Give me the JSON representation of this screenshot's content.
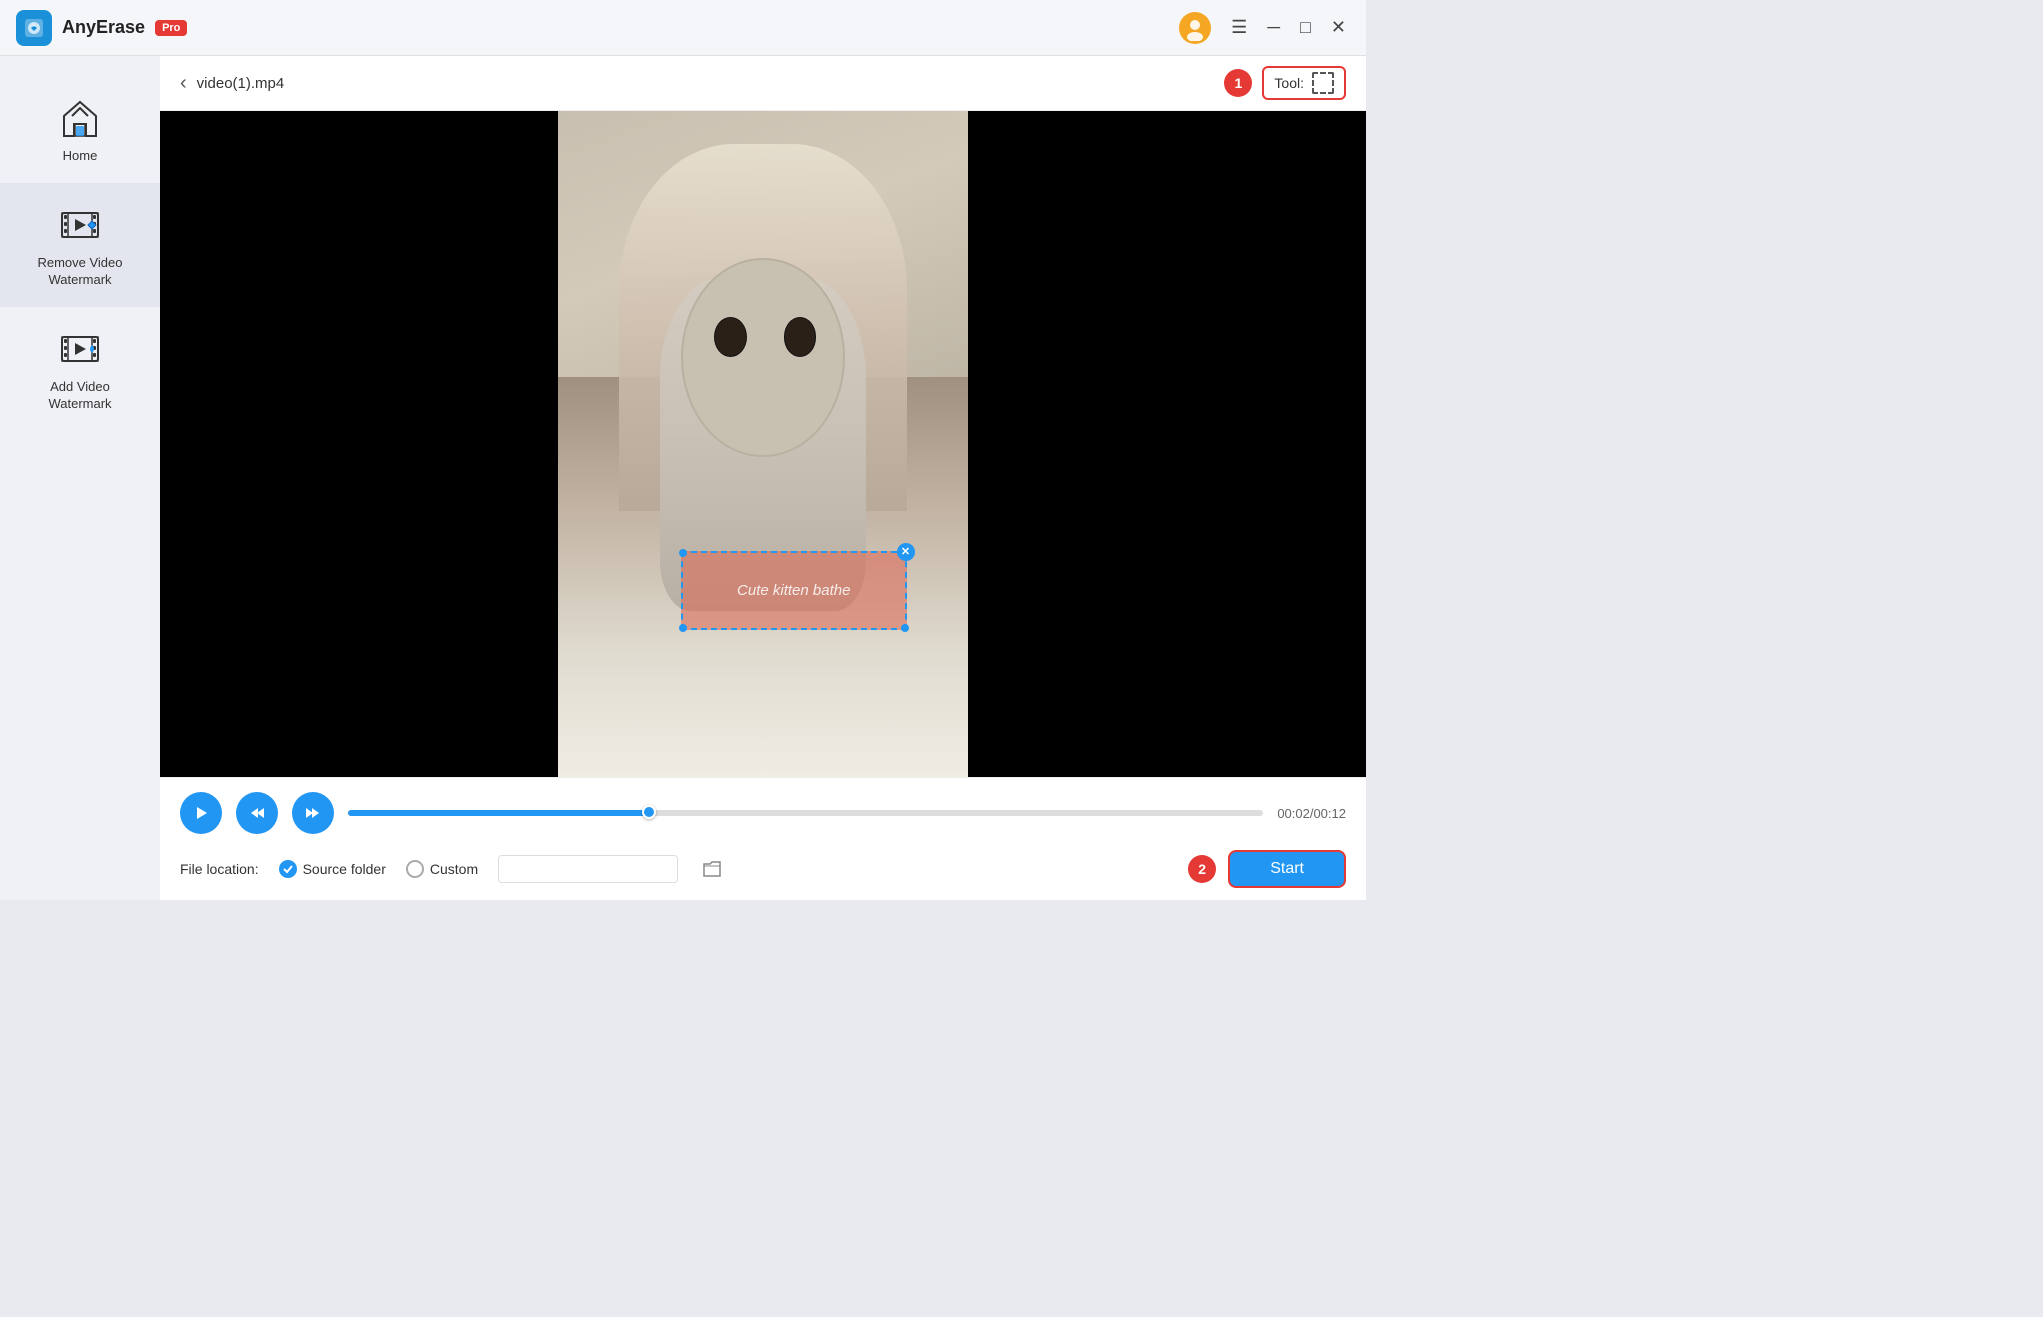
{
  "titlebar": {
    "app_name": "AnyErase",
    "pro_badge": "Pro",
    "avatar_symbol": "👤"
  },
  "sidebar": {
    "items": [
      {
        "id": "home",
        "label": "Home",
        "active": false
      },
      {
        "id": "remove-watermark",
        "label": "Remove Video\nWatermark",
        "active": true
      },
      {
        "id": "add-watermark",
        "label": "Add Video\nWatermark",
        "active": false
      }
    ]
  },
  "content_header": {
    "back_label": "‹",
    "file_name": "video(1).mp4",
    "step1_badge": "1",
    "tool_label": "Tool:",
    "step2_badge": "2"
  },
  "video": {
    "watermark_text": "Cute kitten bathe"
  },
  "player": {
    "time_current": "00:02",
    "time_total": "00:12",
    "time_display": "00:02/00:12"
  },
  "file_location": {
    "label": "File location:",
    "source_folder_label": "Source folder",
    "custom_label": "Custom",
    "start_button_label": "Start"
  }
}
